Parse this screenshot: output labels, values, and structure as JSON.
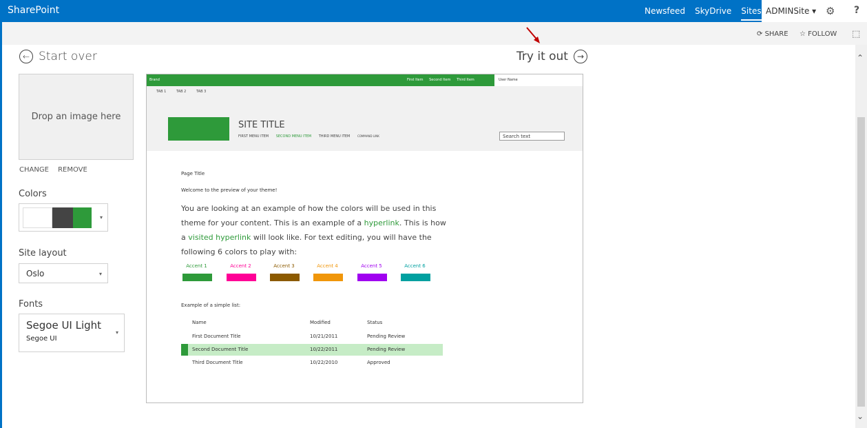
{
  "suitebar": {
    "brand": "SharePoint",
    "links": [
      "Newsfeed",
      "SkyDrive",
      "Sites"
    ],
    "user": "ADMINSite",
    "help": "?"
  },
  "ribbon": {
    "share": "SHARE",
    "follow": "FOLLOW"
  },
  "nav": {
    "start_over": "Start over",
    "try_it_out": "Try it out"
  },
  "left_panel": {
    "drop_image": "Drop an image here",
    "change": "CHANGE",
    "remove": "REMOVE",
    "colors_label": "Colors",
    "color_swatches": [
      "#ffffff",
      "#444444",
      "#2e9a3a"
    ],
    "site_layout_label": "Site layout",
    "site_layout_value": "Oslo",
    "fonts_label": "Fonts",
    "font_heading": "Segoe UI Light",
    "font_body": "Segoe UI"
  },
  "preview": {
    "brand": "Brand",
    "top_items": [
      "First Item",
      "Second Item",
      "Third Item"
    ],
    "user_name": "User Name",
    "tabs": [
      "TAB 1",
      "TAB 2",
      "TAB 3"
    ],
    "site_title": "SITE TITLE",
    "menu": [
      "FIRST MENU ITEM",
      "SECOND MENU ITEM",
      "THIRD MENU ITEM",
      "COMMAND LINK"
    ],
    "search_placeholder": "Search text",
    "page_title": "Page Title",
    "welcome": "Welcome to the preview of your theme!",
    "para_1": "You are looking at an example of how the colors will be used in this theme for your content. This is an example of a ",
    "hyperlink": "hyperlink",
    "para_2": ". This is how a ",
    "visited_hyperlink": "visited hyperlink",
    "para_3": " will look like. For text editing, you will have the following 6 colors to play with:",
    "accents": [
      {
        "label": "Accent 1",
        "color": "#2e9a3a"
      },
      {
        "label": "Accent 2",
        "color": "#ff0096"
      },
      {
        "label": "Accent 3",
        "color": "#8c5a00"
      },
      {
        "label": "Accent 4",
        "color": "#f0960a"
      },
      {
        "label": "Accent 5",
        "color": "#a000f0"
      },
      {
        "label": "Accent 6",
        "color": "#00a0a0"
      }
    ],
    "list_label": "Example of a simple list:",
    "list_headers": [
      "Name",
      "Modified",
      "Status"
    ],
    "list_rows": [
      [
        "First Document Title",
        "10/21/2011",
        "Pending Review"
      ],
      [
        "Second Document Title",
        "10/22/2011",
        "Pending Review"
      ],
      [
        "Third Document Title",
        "10/22/2010",
        "Approved"
      ]
    ]
  },
  "colors": {
    "suite_blue": "#0072c6",
    "theme_green": "#2e9a3a",
    "annotation_red": "#c00000"
  }
}
